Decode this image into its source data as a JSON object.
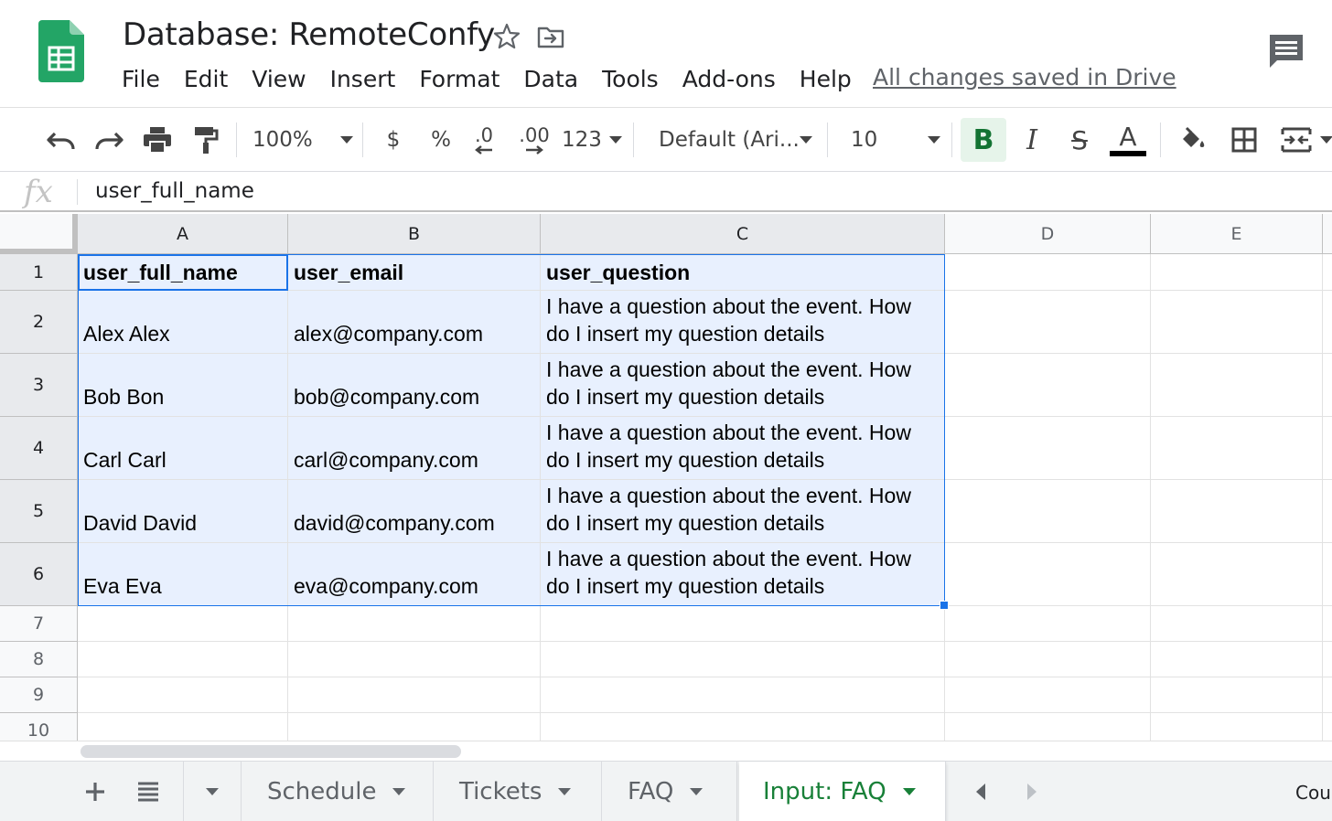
{
  "header": {
    "title": "Database: RemoteConfy",
    "menu": [
      "File",
      "Edit",
      "View",
      "Insert",
      "Format",
      "Data",
      "Tools",
      "Add-ons",
      "Help"
    ],
    "save_status": "All changes saved in Drive"
  },
  "toolbar": {
    "zoom": "100%",
    "currency": "$",
    "percent": "%",
    "decrease_decimal": ".0",
    "increase_decimal": ".00",
    "more_formats": "123",
    "font": "Default (Ari...",
    "font_size": "10",
    "bold": "B",
    "italic": "I",
    "strike": "S",
    "text_color": "A",
    "accent_color": "#137333"
  },
  "formula_bar": {
    "fx": "fx",
    "value": "user_full_name"
  },
  "grid": {
    "columns": [
      "A",
      "B",
      "C",
      "D",
      "E"
    ],
    "row_numbers": [
      "1",
      "2",
      "3",
      "4",
      "5",
      "6",
      "7",
      "8",
      "9",
      "10"
    ],
    "header_row": [
      "user_full_name",
      "user_email",
      "user_question"
    ],
    "rows": [
      [
        "Alex Alex",
        "alex@company.com",
        "I have a question about the event. How do I insert my question details"
      ],
      [
        "Bob Bon",
        "bob@company.com",
        "I have a question about the event. How do I insert my question details"
      ],
      [
        "Carl Carl",
        "carl@company.com",
        "I have a question about the event. How do I insert my question details"
      ],
      [
        "David David",
        "david@company.com",
        "I have a question about the event. How do I insert my question details"
      ],
      [
        "Eva Eva",
        "eva@company.com",
        "I have a question about the event. How do I insert my question details"
      ]
    ],
    "selection_color": "#1a73e8"
  },
  "sheet_tabs": {
    "tabs": [
      "Schedule",
      "Tickets",
      "FAQ",
      "Input: FAQ"
    ],
    "active": "Input: FAQ",
    "explore_label": "Cou"
  }
}
